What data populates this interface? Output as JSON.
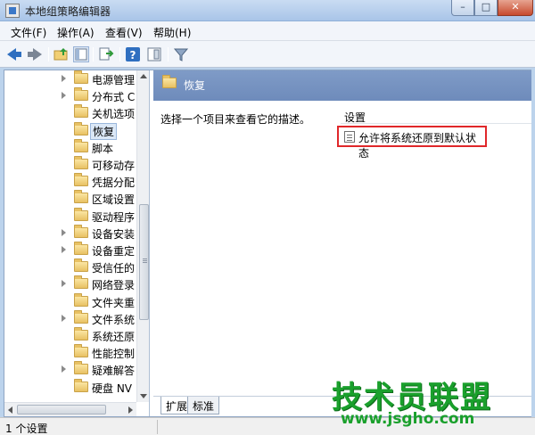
{
  "window": {
    "title": "本地组策略编辑器",
    "min": "–",
    "max": "□",
    "close": "✕"
  },
  "menu": [
    "文件(F)",
    "操作(A)",
    "查看(V)",
    "帮助(H)"
  ],
  "toolbar": {
    "icons": [
      "back-icon",
      "forward-icon",
      "up-folder-icon",
      "show-hide-tree-icon",
      "export-list-icon",
      "help-icon",
      "properties-icon",
      "filter-icon"
    ]
  },
  "tree": {
    "items": [
      {
        "label": "电源管理",
        "expandable": true
      },
      {
        "label": "分布式 C",
        "expandable": true
      },
      {
        "label": "关机选项",
        "expandable": false
      },
      {
        "label": "恢复",
        "expandable": false,
        "selected": true
      },
      {
        "label": "脚本",
        "expandable": false
      },
      {
        "label": "可移动存",
        "expandable": false
      },
      {
        "label": "凭据分配",
        "expandable": false
      },
      {
        "label": "区域设置",
        "expandable": false
      },
      {
        "label": "驱动程序",
        "expandable": false
      },
      {
        "label": "设备安装",
        "expandable": true
      },
      {
        "label": "设备重定",
        "expandable": true
      },
      {
        "label": "受信任的",
        "expandable": false
      },
      {
        "label": "网络登录",
        "expandable": true
      },
      {
        "label": "文件夹重",
        "expandable": false
      },
      {
        "label": "文件系统",
        "expandable": true
      },
      {
        "label": "系统还原",
        "expandable": false
      },
      {
        "label": "性能控制",
        "expandable": false
      },
      {
        "label": "疑难解答",
        "expandable": true
      },
      {
        "label": "硬盘 NV",
        "expandable": false
      }
    ]
  },
  "content": {
    "header_title": "恢复",
    "description": "选择一个项目来查看它的描述。",
    "column_header": "设置",
    "settings": [
      "允许将系统还原到默认状态"
    ],
    "tabs": [
      "扩展",
      "标准"
    ]
  },
  "status": {
    "text": "1 个设置"
  },
  "watermark": {
    "big": "技术员联盟",
    "url": "www.jsgho.com"
  },
  "colors": {
    "title_bar": "#a9c5e8",
    "header": "#6e8bbb",
    "highlight_border": "#e0272a",
    "watermark": "#1aa02c"
  }
}
